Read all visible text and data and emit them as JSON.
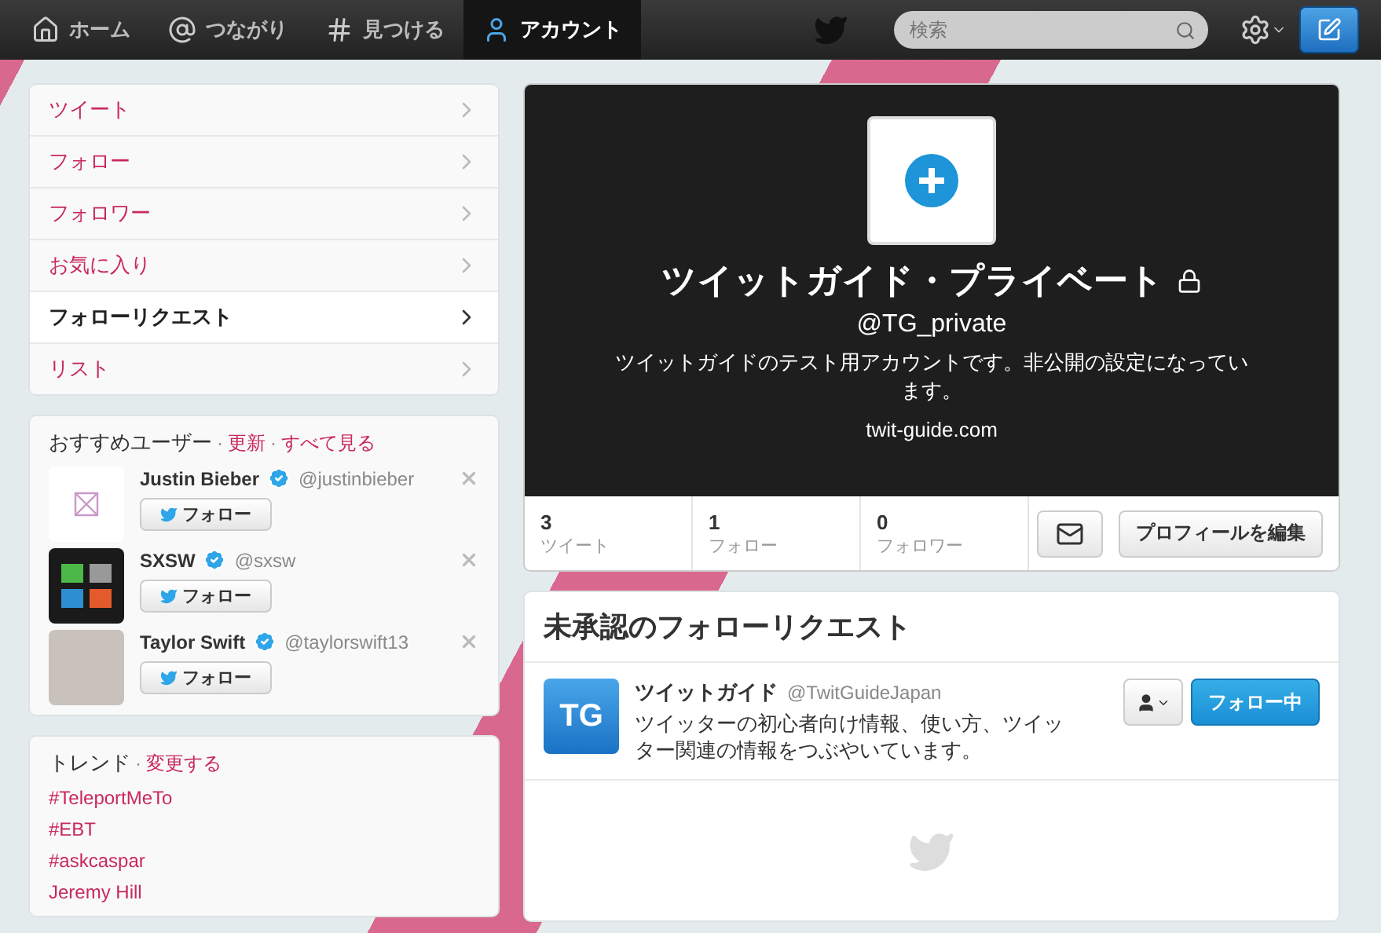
{
  "nav": {
    "tabs": [
      {
        "label": "ホーム",
        "selected": false
      },
      {
        "label": "つながり",
        "selected": false
      },
      {
        "label": "見つける",
        "selected": false
      },
      {
        "label": "アカウント",
        "selected": true
      }
    ],
    "search": {
      "placeholder": "検索"
    }
  },
  "menu": [
    {
      "label": "ツイート",
      "selected": false
    },
    {
      "label": "フォロー",
      "selected": false
    },
    {
      "label": "フォロワー",
      "selected": false
    },
    {
      "label": "お気に入り",
      "selected": false
    },
    {
      "label": "フォローリクエスト",
      "selected": true
    },
    {
      "label": "リスト",
      "selected": false
    }
  ],
  "suggestions": {
    "title": "おすすめユーザー",
    "separator": "·",
    "links": [
      "更新",
      "すべて見る"
    ],
    "users": [
      {
        "name": "Justin Bieber",
        "handle": "@justinbieber",
        "verified": true,
        "kind": "light-logo",
        "follow_label": "フォロー"
      },
      {
        "name": "SXSW",
        "handle": "@sxsw",
        "verified": true,
        "kind": "dark-logo",
        "follow_label": "フォロー"
      },
      {
        "name": "Taylor Swift",
        "handle": "@taylorswift13",
        "verified": true,
        "kind": "photo",
        "follow_label": "フォロー"
      }
    ]
  },
  "trends": {
    "title": "トレンド",
    "separator": "·",
    "link": "変更する",
    "items": [
      "#TeleportMeTo",
      "#EBT",
      "#askcaspar",
      "Jeremy Hill"
    ]
  },
  "profile": {
    "name": "ツイットガイド・プライベート",
    "protected": true,
    "handle": "@TG_private",
    "bio": "ツイットガイドのテスト用アカウントです。非公開の設定になっています。",
    "url": "twit-guide.com",
    "stats": [
      {
        "value": "3",
        "label": "ツイート"
      },
      {
        "value": "1",
        "label": "フォロー"
      },
      {
        "value": "0",
        "label": "フォロワー"
      }
    ],
    "edit_label": "プロフィールを編集"
  },
  "requests": {
    "title": "未承認のフォローリクエスト",
    "items": [
      {
        "name": "ツイットガイド",
        "handle": "@TwitGuideJapan",
        "bio": "ツイッターの初心者向け情報、使い方、ツイッター関連の情報をつぶやいています。",
        "avatar_text": "TG",
        "button_label": "フォロー中",
        "following": true
      }
    ]
  }
}
